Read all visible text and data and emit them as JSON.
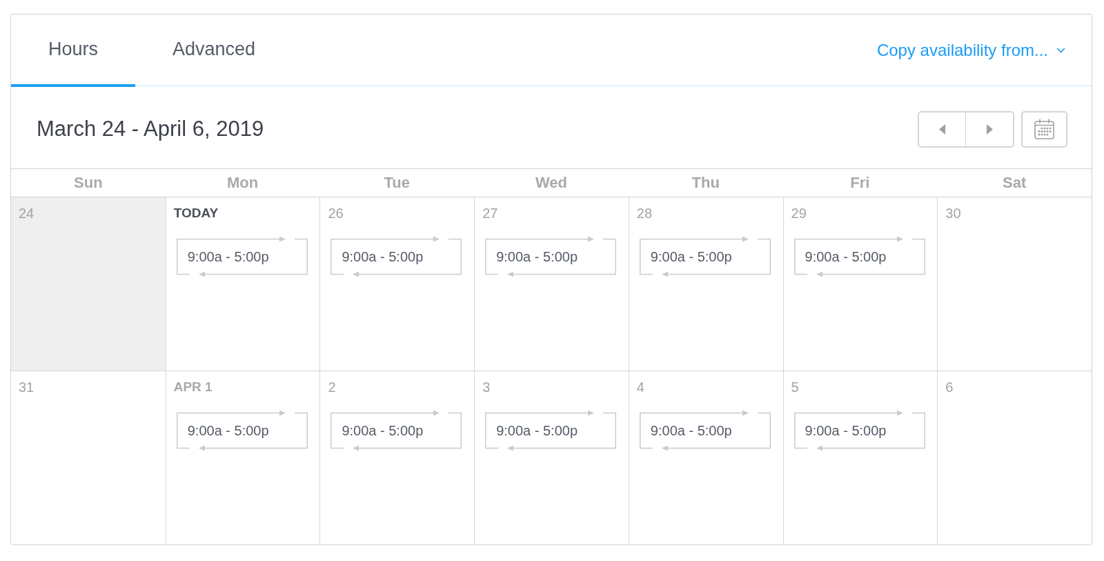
{
  "tabs": [
    {
      "label": "Hours",
      "selected": true
    },
    {
      "label": "Advanced",
      "selected": false
    }
  ],
  "copy_menu": {
    "label": "Copy availability from..."
  },
  "date_range": "March 24 - April 6, 2019",
  "weekdays": [
    "Sun",
    "Mon",
    "Tue",
    "Wed",
    "Thu",
    "Fri",
    "Sat"
  ],
  "weeks": [
    {
      "days": [
        {
          "label": "24",
          "kind": "day",
          "disabled": true
        },
        {
          "label": "TODAY",
          "kind": "today",
          "disabled": false,
          "hours": "9:00a - 5:00p"
        },
        {
          "label": "26",
          "kind": "day",
          "disabled": false,
          "hours": "9:00a - 5:00p"
        },
        {
          "label": "27",
          "kind": "day",
          "disabled": false,
          "hours": "9:00a - 5:00p"
        },
        {
          "label": "28",
          "kind": "day",
          "disabled": false,
          "hours": "9:00a - 5:00p"
        },
        {
          "label": "29",
          "kind": "day",
          "disabled": false,
          "hours": "9:00a - 5:00p"
        },
        {
          "label": "30",
          "kind": "day",
          "disabled": false
        }
      ]
    },
    {
      "days": [
        {
          "label": "31",
          "kind": "day",
          "disabled": false
        },
        {
          "label": "APR 1",
          "kind": "month",
          "disabled": false,
          "hours": "9:00a - 5:00p"
        },
        {
          "label": "2",
          "kind": "day",
          "disabled": false,
          "hours": "9:00a - 5:00p"
        },
        {
          "label": "3",
          "kind": "day",
          "disabled": false,
          "hours": "9:00a - 5:00p"
        },
        {
          "label": "4",
          "kind": "day",
          "disabled": false,
          "hours": "9:00a - 5:00p"
        },
        {
          "label": "5",
          "kind": "day",
          "disabled": false,
          "hours": "9:00a - 5:00p"
        },
        {
          "label": "6",
          "kind": "day",
          "disabled": false
        }
      ]
    }
  ]
}
